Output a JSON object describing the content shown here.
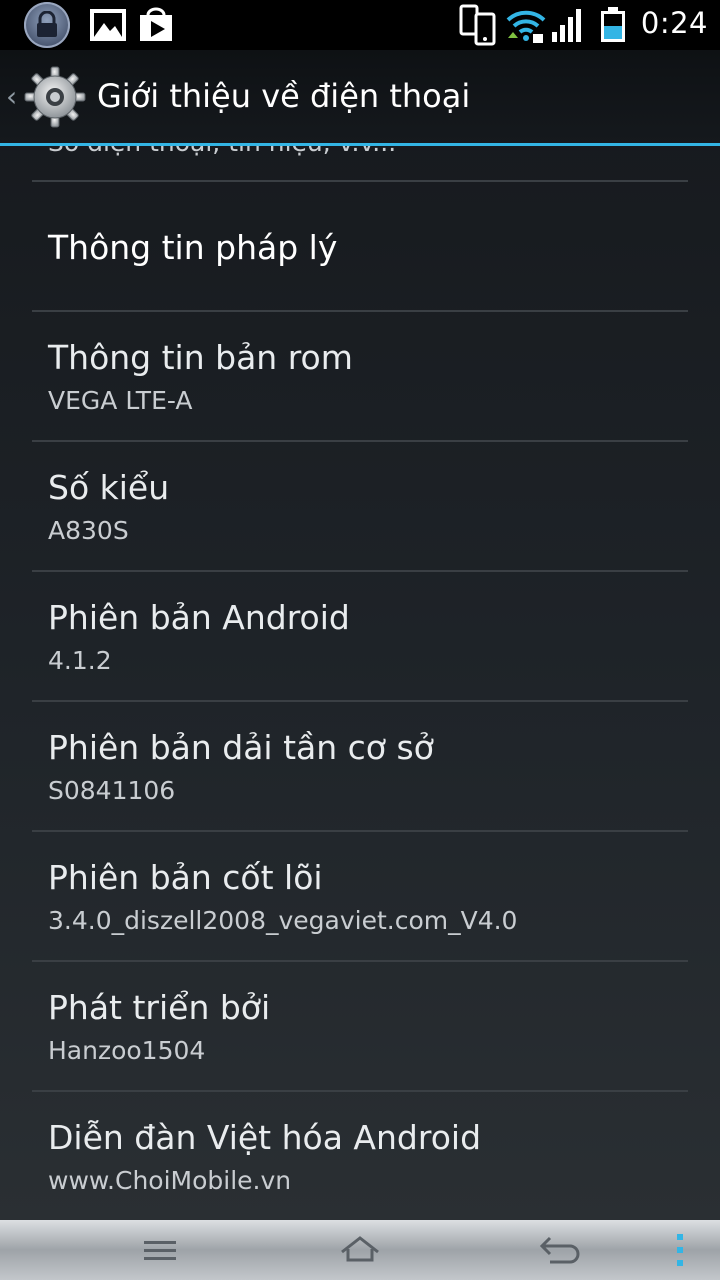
{
  "status_bar": {
    "time": "0:24",
    "icons": [
      "lock-icon",
      "gallery-icon",
      "play-store-icon",
      "phone-sync-icon",
      "wifi-icon",
      "signal-icon",
      "battery-icon"
    ]
  },
  "action_bar": {
    "title": "Giới thiệu về điện thoại",
    "icon": "settings-gear-icon"
  },
  "list": {
    "partial_text": "Số điện thoại, tín hiệu, v.v...",
    "items": [
      {
        "title": "Thông tin pháp lý"
      },
      {
        "title": "Thông tin bản rom",
        "value": "VEGA LTE-A"
      },
      {
        "title": "Số kiểu",
        "value": "A830S"
      },
      {
        "title": "Phiên bản Android",
        "value": "4.1.2"
      },
      {
        "title": "Phiên bản dải tần cơ sở",
        "value": "S0841106"
      },
      {
        "title": "Phiên bản cốt lõi",
        "value": "3.4.0_diszell2008_vegaviet.com_V4.0"
      },
      {
        "title": "Phát triển bởi",
        "value": "Hanzoo1504"
      },
      {
        "title": "Diễn đàn Việt hóa Android",
        "value": "www.ChoiMobile.vn"
      }
    ]
  },
  "nav_bar": {
    "buttons": [
      "menu",
      "home",
      "back",
      "overflow"
    ]
  },
  "colors": {
    "accent": "#33b5e5",
    "background": "#1f2429",
    "divider": "#3a3f44"
  }
}
